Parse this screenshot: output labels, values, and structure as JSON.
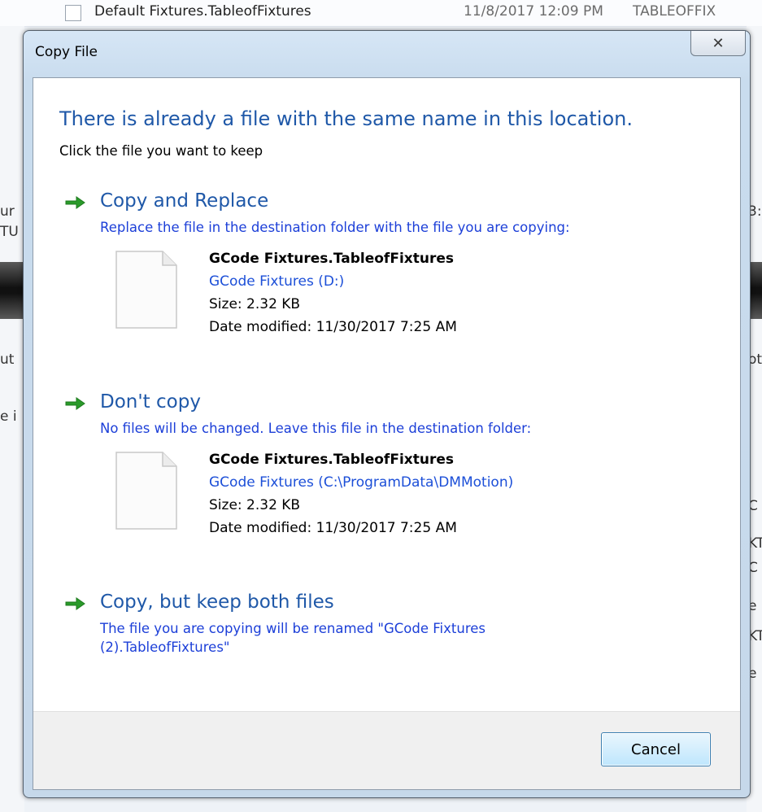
{
  "background": {
    "top_row": {
      "filename": "Default Fixtures.TableofFixtures",
      "date": "11/8/2017 12:09 PM",
      "type": "TABLEOFFIX"
    },
    "fragments_left": [
      "ur",
      "TU",
      "ut",
      "e i"
    ],
    "fragments_right": [
      "3:",
      "ot",
      "C",
      "KT",
      "C",
      "e",
      "KT",
      "e"
    ]
  },
  "dialog": {
    "title": "Copy File",
    "close_symbol": "✕",
    "main_instruction": "There is already a file with the same name in this location.",
    "sub_instruction": "Click the file you want to keep",
    "options": [
      {
        "title": "Copy and Replace",
        "description": "Replace the file in the destination folder with the file you are copying:",
        "file": {
          "name": "GCode Fixtures.TableofFixtures",
          "location": "GCode Fixtures (D:)",
          "size": "Size: 2.32 KB",
          "date_modified": "Date modified: 11/30/2017 7:25 AM"
        }
      },
      {
        "title": "Don't copy",
        "description": "No files will be changed. Leave this file in the destination folder:",
        "file": {
          "name": "GCode Fixtures.TableofFixtures",
          "location": "GCode Fixtures (C:\\ProgramData\\DMMotion)",
          "size": "Size: 2.32 KB",
          "date_modified": "Date modified: 11/30/2017 7:25 AM"
        }
      },
      {
        "title": "Copy, but keep both files",
        "description_line1": "The file you are copying will be renamed \"GCode Fixtures",
        "description_line2": "(2).TableofFixtures\""
      }
    ],
    "cancel_label": "Cancel"
  },
  "colors": {
    "instruction_blue": "#1f58a8",
    "link_blue": "#1c3fd8",
    "arrow_green": "#2a9a2a"
  },
  "icons": {
    "arrow": "green-right-arrow",
    "file": "blank-document",
    "close": "close-x"
  }
}
